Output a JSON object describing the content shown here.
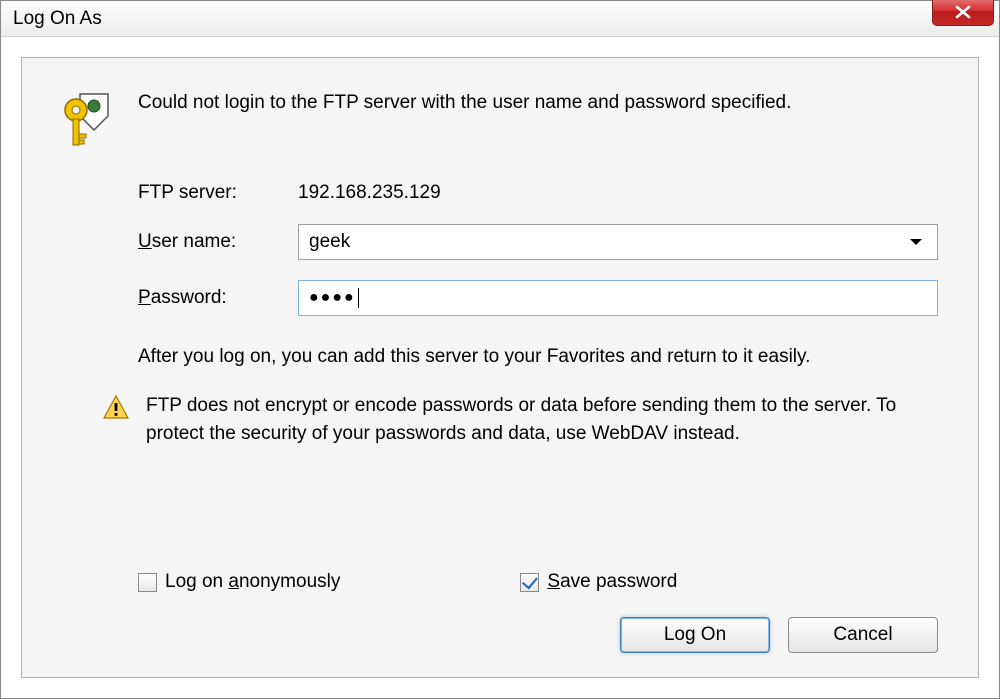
{
  "title": "Log On As",
  "message": "Could not login to the FTP server with the user name and password specified.",
  "form": {
    "server_label": "FTP server:",
    "server_value": "192.168.235.129",
    "user_label": "User name:",
    "user_value": "geek",
    "password_label": "Password:",
    "password_masked": "●●●●"
  },
  "hint": "After you log on, you can add this server to your Favorites and return to it easily.",
  "warning": "FTP does not encrypt or encode passwords or data before sending them to the server.  To protect the security of your passwords and data, use WebDAV instead.",
  "checks": {
    "anon_label_pre": "Log on ",
    "anon_label_u": "a",
    "anon_label_post": "nonymously",
    "anon_checked": false,
    "save_label_u": "S",
    "save_label_post": "ave password",
    "save_checked": true
  },
  "buttons": {
    "logon": "Log On",
    "cancel": "Cancel"
  }
}
